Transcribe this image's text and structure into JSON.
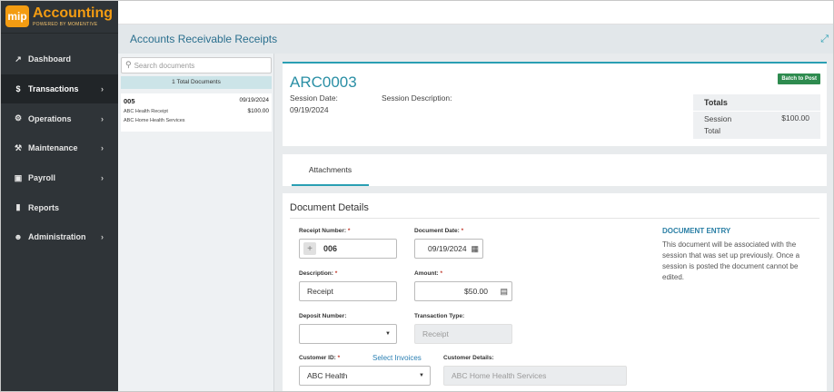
{
  "app": {
    "logo_mark": "mip",
    "logo_title": "Accounting",
    "logo_subtitle": "POWERED BY MOMENTIVE",
    "accent": "#2a9fb3",
    "brand": "#f39c12"
  },
  "sidebar": {
    "items": [
      {
        "label": "Dashboard",
        "icon": "chart-line-icon",
        "glyph": "↗",
        "active": false,
        "has_children": false
      },
      {
        "label": "Transactions",
        "icon": "dollar-icon",
        "glyph": "$",
        "active": true,
        "has_children": true
      },
      {
        "label": "Operations",
        "icon": "cogs-icon",
        "glyph": "⚙",
        "active": false,
        "has_children": true
      },
      {
        "label": "Maintenance",
        "icon": "wrench-icon",
        "glyph": "⚒",
        "active": false,
        "has_children": true
      },
      {
        "label": "Payroll",
        "icon": "money-icon",
        "glyph": "▣",
        "active": false,
        "has_children": true
      },
      {
        "label": "Reports",
        "icon": "file-icon",
        "glyph": "▮",
        "active": false,
        "has_children": false
      },
      {
        "label": "Administration",
        "icon": "users-icon",
        "glyph": "☻",
        "active": false,
        "has_children": true
      }
    ],
    "chevron": "›"
  },
  "header": {
    "title": "Accounts Receivable Receipts",
    "expand_icon": "expand-icon"
  },
  "doc_list": {
    "search_placeholder": "Search documents",
    "total_label": "1 Total Documents",
    "items": [
      {
        "number": "005",
        "date": "09/19/2024",
        "description": "ABC Health Receipt",
        "amount": "$100.00",
        "customer": "ABC Home Health Services"
      }
    ]
  },
  "session": {
    "id": "ARC0003",
    "date_label": "Session Date:",
    "date": "09/19/2024",
    "description_label": "Session Description:",
    "batch_button": "Batch to Post",
    "totals_heading": "Totals",
    "session_total_label": "Session Total",
    "session_total_value": "$100.00"
  },
  "tabs": {
    "attachments": "Attachments"
  },
  "details": {
    "title": "Document Details",
    "receipt_number_label": "Receipt Number:",
    "receipt_number": "006",
    "document_date_label": "Document Date:",
    "document_date": "09/19/2024",
    "description_label": "Description:",
    "description": "Receipt",
    "amount_label": "Amount:",
    "amount": "$50.00",
    "deposit_number_label": "Deposit Number:",
    "deposit_number": "",
    "transaction_type_label": "Transaction Type:",
    "transaction_type": "Receipt",
    "customer_id_label": "Customer ID:",
    "select_invoices": "Select Invoices",
    "customer_id": "ABC Health",
    "customer_details_label": "Customer Details:",
    "customer_details": "ABC Home Health Services",
    "required_mark": "*"
  },
  "entry_help": {
    "title": "DOCUMENT ENTRY",
    "text": "This document will be associated with the session that was set up previously. Once a session is posted the document cannot be edited."
  }
}
